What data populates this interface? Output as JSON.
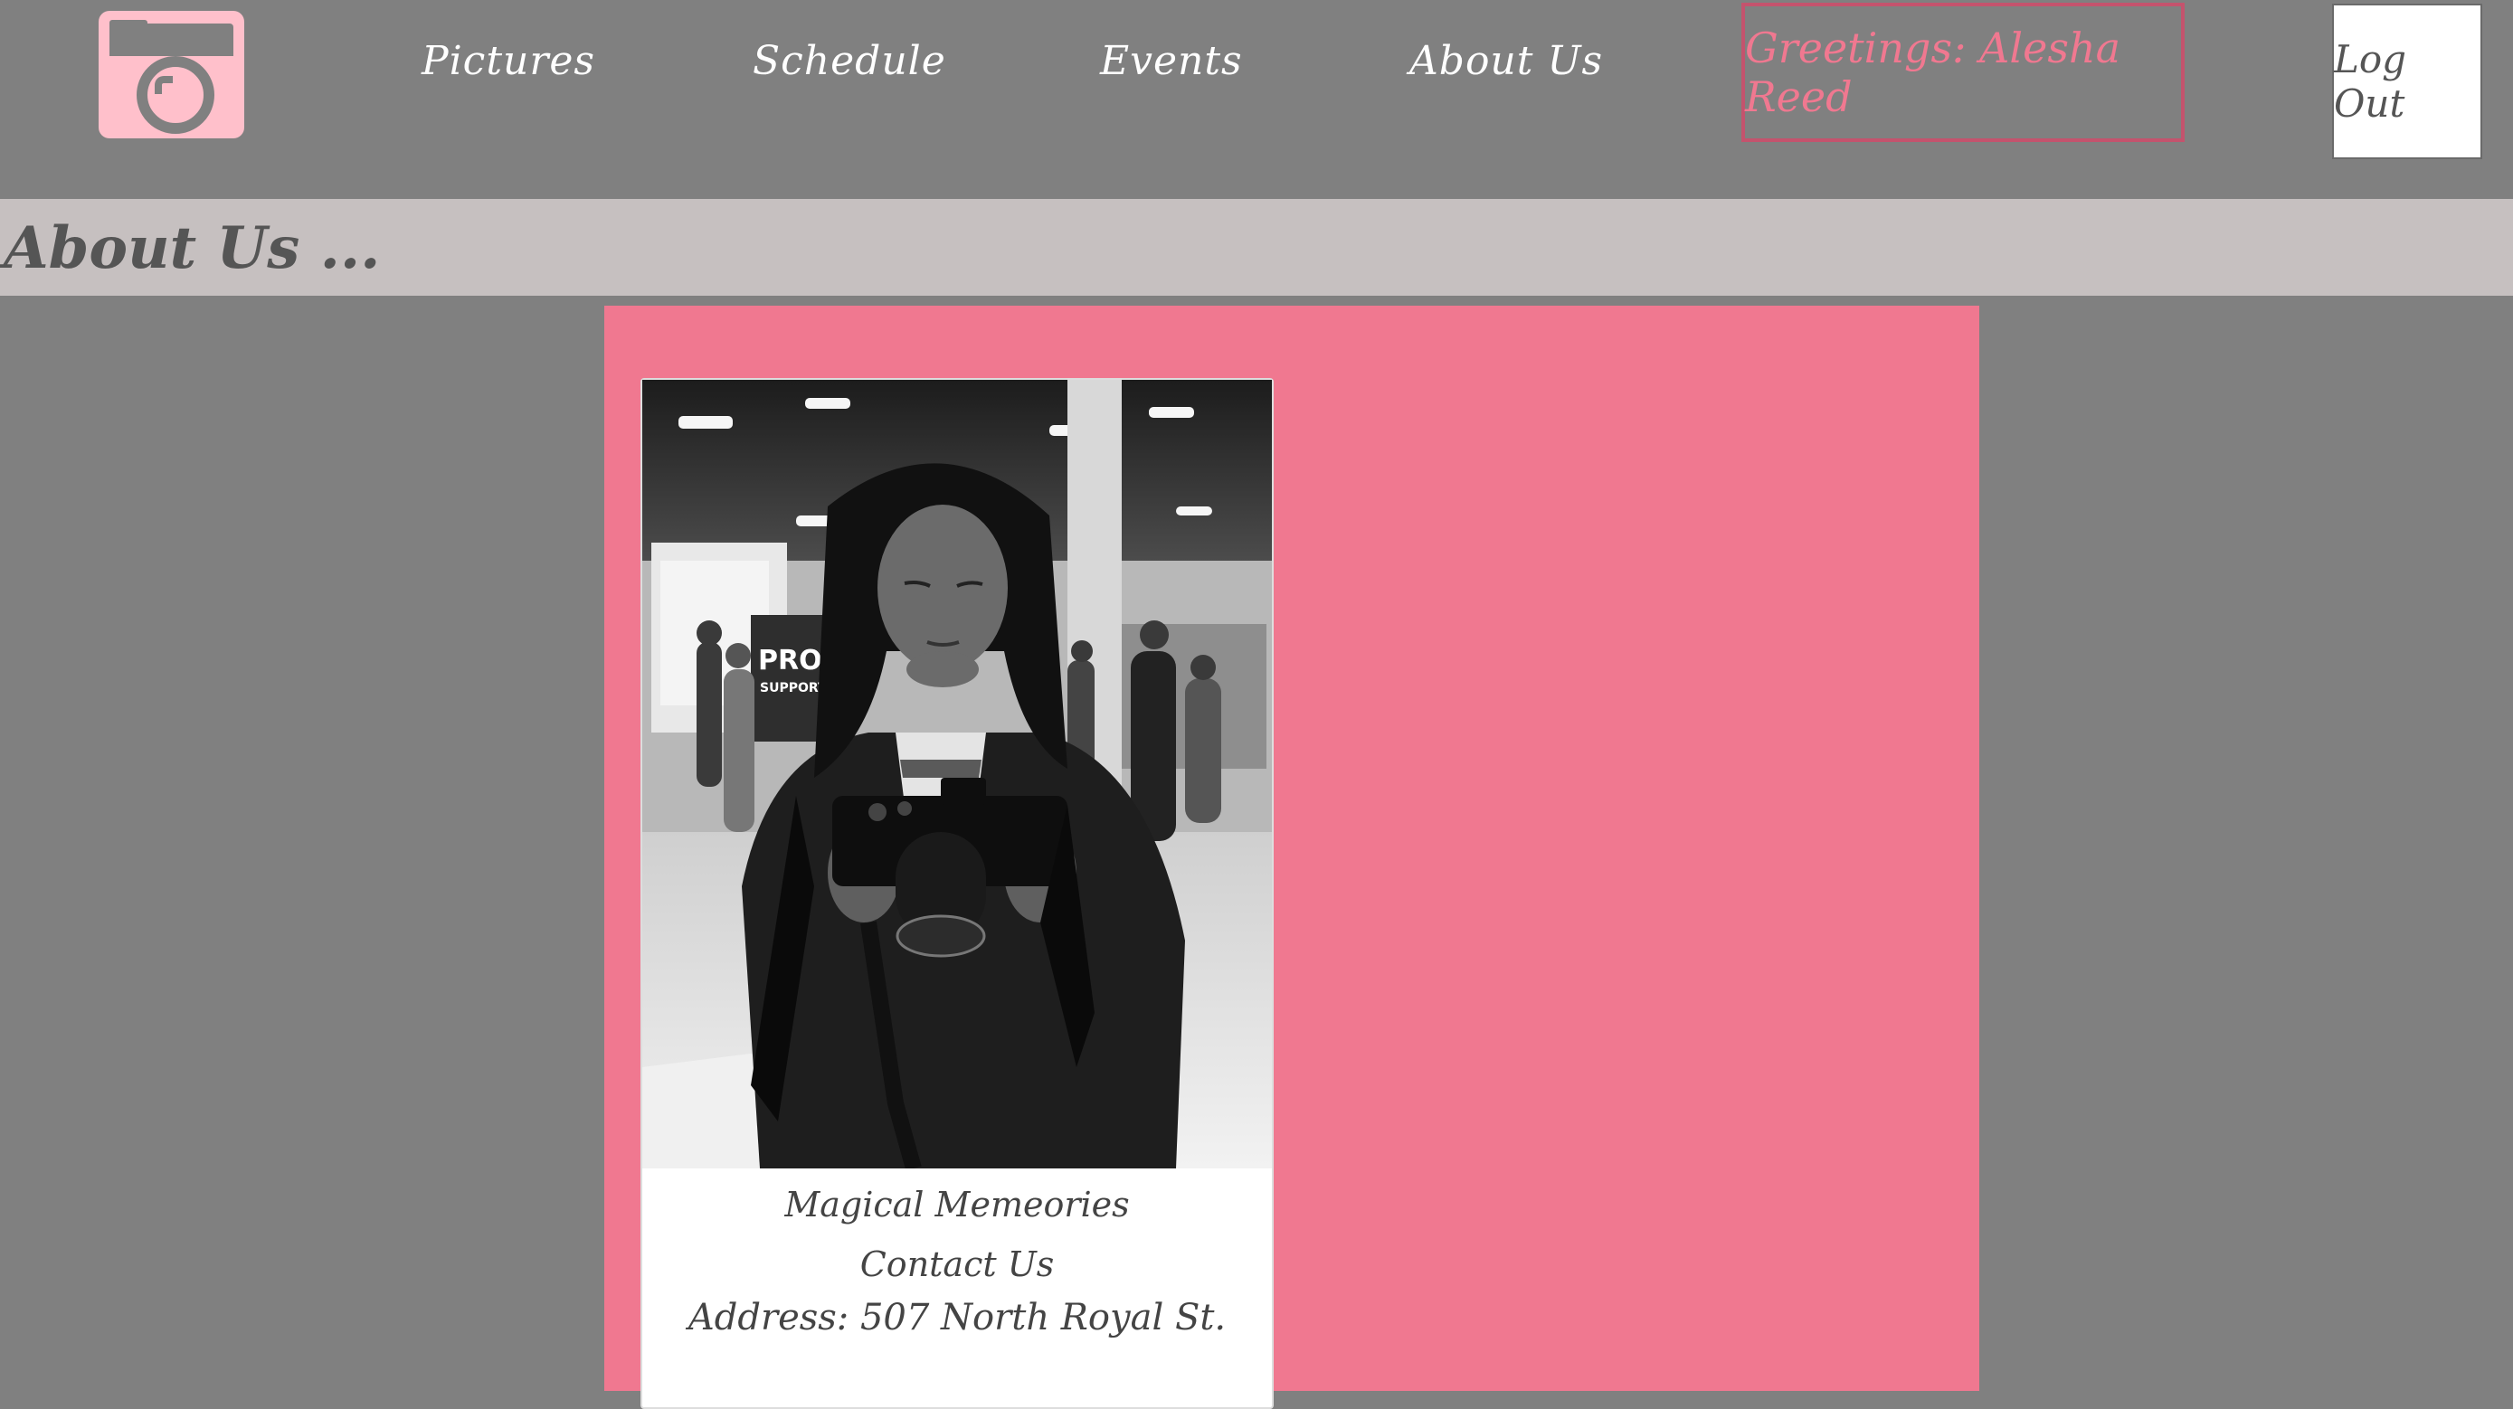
{
  "nav": {
    "logo_icon": "camera-icon",
    "links": [
      "Pictures",
      "Schedule",
      "Events",
      "About Us"
    ],
    "greeting": "Greetings: Alesha Reed",
    "logout_label": "Log Out"
  },
  "section": {
    "title": "About Us ..."
  },
  "card": {
    "photo_alt": "person-holding-camera-photo",
    "name": "Magical Memeories",
    "contact_heading": "Contact Us",
    "address": "Address: 507 North Royal St."
  },
  "colors": {
    "background": "#808080",
    "logo": "#ffc0cb",
    "accent_pink": "#f07890",
    "greeting_border": "#c4536d",
    "section_band": "#c6c0c0",
    "card": "#ffffff"
  }
}
